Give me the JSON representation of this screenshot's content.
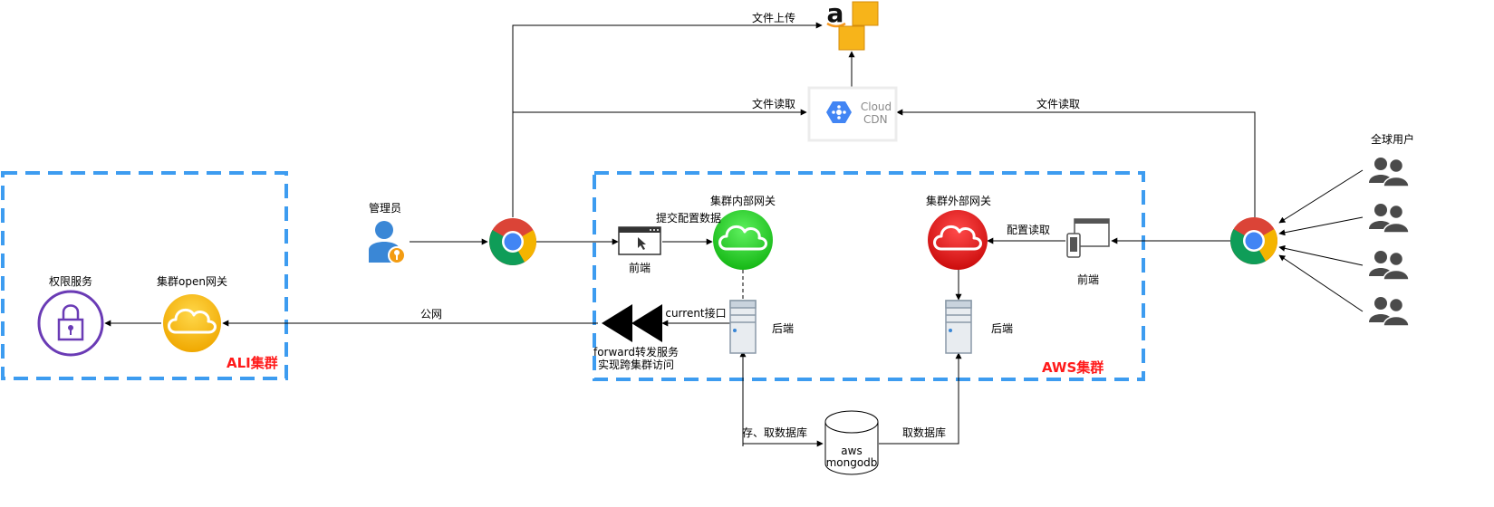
{
  "clusters": {
    "ali": {
      "label": "ALI集群"
    },
    "aws": {
      "label": "AWS集群"
    }
  },
  "nodes": {
    "permission_service": "权限服务",
    "open_gateway": "集群open网关",
    "admin": "管理员",
    "internal_gateway": "集群内部网关",
    "external_gateway": "集群外部网关",
    "frontend_left": "前端",
    "frontend_right": "前端",
    "backend_left": "后端",
    "backend_right": "后端",
    "global_users": "全球用户",
    "cloud_cdn": {
      "line1": "Cloud",
      "line2": "CDN"
    },
    "mongodb": {
      "line1": "aws",
      "line2": "mongodb"
    },
    "forward_service": {
      "line1": "forward转发服务",
      "line2": "实现跨集群访问"
    }
  },
  "edges": {
    "file_upload": "文件上传",
    "file_read_admin": "文件读取",
    "file_read_user": "文件读取",
    "submit_config": "提交配置数据",
    "read_config": "配置读取",
    "current_api": "current接口",
    "public_net": "公网",
    "save_fetch_db": "存、取数据库",
    "fetch_db": "取数据库"
  },
  "colors": {
    "cluster_border": "#3d9cf0",
    "cluster_label": "#ff1a1a",
    "permission_purple": "#6a3bb5",
    "open_gateway_yellow": "#f5b800",
    "internal_gateway_green": "#2fd12f",
    "external_gateway_red": "#e01b1b",
    "admin_blue": "#3a87d6",
    "users_gray": "#4a4a4a"
  },
  "icons": [
    "amazon-s3-icon",
    "cloud-cdn-icon",
    "chrome-icon",
    "browser-window-icon",
    "mobile-browser-icon",
    "server-icon",
    "database-icon",
    "lock-icon",
    "cloud-gateway-icon",
    "admin-user-icon",
    "users-group-icon",
    "forward-arrow-icon"
  ]
}
